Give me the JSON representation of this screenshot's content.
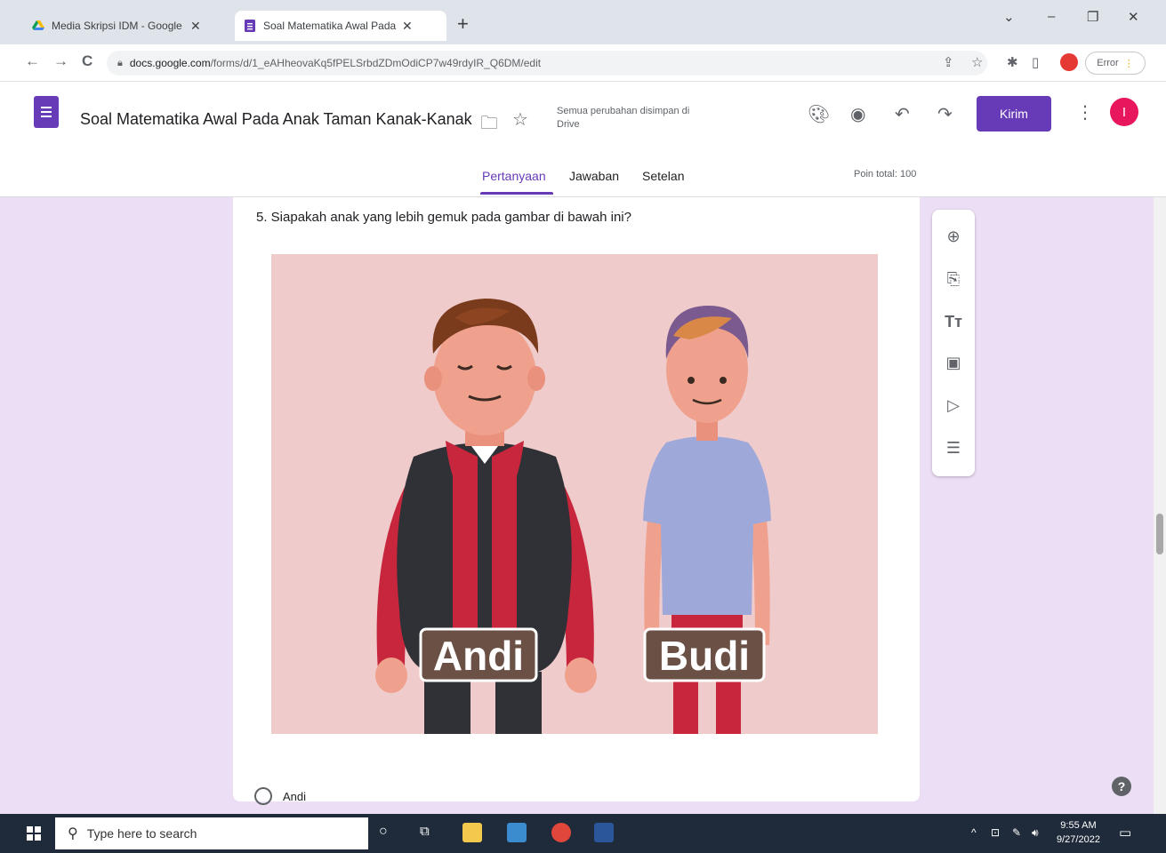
{
  "browser": {
    "tabs": [
      {
        "title": "Media Skripsi IDM - Google Drive",
        "active": false
      },
      {
        "title": "Soal Matematika Awal Pada Anak",
        "active": true
      }
    ],
    "new_tab": "+",
    "window_controls": {
      "chevron": "⌄",
      "minimize": "–",
      "restore": "❐",
      "close": "✕"
    },
    "nav": {
      "back": "←",
      "forward": "→",
      "reload": "C"
    },
    "url_host": "docs.google.com",
    "url_path": "/forms/d/1_eAHheovaKq5fPELSrbdZDmOdiCP7w49rdyIR_Q6DM/edit",
    "error_button": "Error"
  },
  "form": {
    "title": "Soal Matematika Awal Pada Anak Taman Kanak-Kanak",
    "save_status": "Semua perubahan disimpan di Drive",
    "send_button": "Kirim",
    "avatar_letter": "I",
    "tabs": [
      "Pertanyaan",
      "Jawaban",
      "Setelan"
    ],
    "active_tab": "Pertanyaan",
    "total_points": "Poin total: 100",
    "question": {
      "text": "5. Siapakah anak yang lebih gemuk pada gambar di bawah ini?",
      "image_labels": [
        "Andi",
        "Budi"
      ],
      "options": [
        "Andi"
      ]
    },
    "sidebar_icons": [
      "add-question-icon",
      "import-questions-icon",
      "add-title-icon",
      "add-image-icon",
      "add-video-icon",
      "add-section-icon"
    ]
  },
  "taskbar": {
    "search_placeholder": "Type here to search",
    "time": "9:55 AM",
    "date": "9/27/2022"
  },
  "colors": {
    "accent": "#673ab7",
    "canvas": "#ecdff5",
    "avatar": "#e8175d",
    "image_background": "#efcbcb"
  }
}
